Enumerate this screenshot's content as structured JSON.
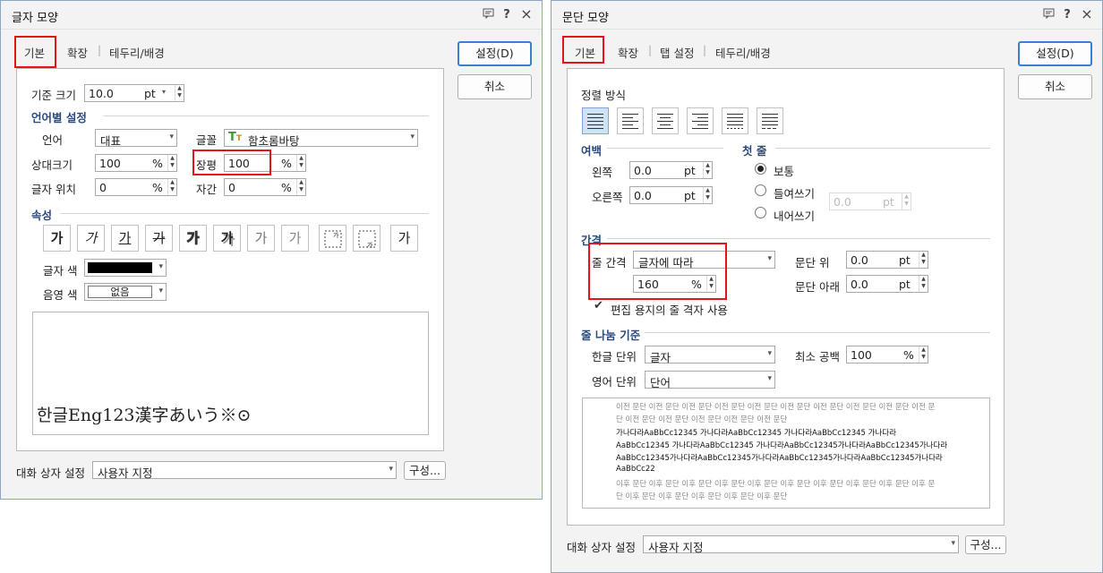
{
  "char_dialog": {
    "title": "글자 모양",
    "tabs": [
      "기본",
      "확장",
      "테두리/배경"
    ],
    "buttons": {
      "ok": "설정(D)",
      "cancel": "취소",
      "config": "구성..."
    },
    "base_size": {
      "label": "기준 크기",
      "value": "10.0",
      "unit": "pt"
    },
    "lang_section": "언어별 설정",
    "language": {
      "label": "언어",
      "value": "대표"
    },
    "font": {
      "label": "글꼴",
      "value": "함초롬바탕",
      "icon": "truetype-font-icon"
    },
    "rel_size": {
      "label": "상대크기",
      "value": "100",
      "unit": "%"
    },
    "width_ratio": {
      "label": "장평",
      "value": "100",
      "unit": "%"
    },
    "char_pos": {
      "label": "글자 위치",
      "value": "0",
      "unit": "%"
    },
    "spacing": {
      "label": "자간",
      "value": "0",
      "unit": "%"
    },
    "attr_section": "속성",
    "attributes": [
      "가",
      "가",
      "가",
      "가",
      "가",
      "가",
      "가",
      "가",
      "가"
    ],
    "text_color": {
      "label": "글자 색",
      "value": "#000000"
    },
    "shade_color": {
      "label": "음영 색",
      "value": "없음"
    },
    "preview_text": "한글Eng123漢字あいう※⊙",
    "dialog_setting": {
      "label": "대화 상자 설정",
      "value": "사용자 지정"
    }
  },
  "para_dialog": {
    "title": "문단 모양",
    "tabs": [
      "기본",
      "확장",
      "탭 설정",
      "테두리/배경"
    ],
    "buttons": {
      "ok": "설정(D)",
      "cancel": "취소",
      "config": "구성..."
    },
    "align_label": "정렬 방식",
    "align_options": [
      "justify-align-icon",
      "left-align-icon",
      "center-align-icon",
      "right-align-icon",
      "distribute-align-icon",
      "divide-align-icon"
    ],
    "margin_section": "여백",
    "left": {
      "label": "왼쪽",
      "value": "0.0",
      "unit": "pt"
    },
    "right": {
      "label": "오른쪽",
      "value": "0.0",
      "unit": "pt"
    },
    "first_line_section": "첫 줄",
    "first_line_options": [
      "보통",
      "들여쓰기",
      "내어쓰기"
    ],
    "first_line_value": {
      "value": "0.0",
      "unit": "pt"
    },
    "spacing_section": "간격",
    "line_spacing": {
      "label": "줄 간격",
      "value": "글자에 따라",
      "amount": "160",
      "unit": "%"
    },
    "para_above": {
      "label": "문단 위",
      "value": "0.0",
      "unit": "pt"
    },
    "para_below": {
      "label": "문단 아래",
      "value": "0.0",
      "unit": "pt"
    },
    "grid_check": "편집 용지의 줄 격자 사용",
    "break_section": "줄 나눔 기준",
    "korean_unit": {
      "label": "한글 단위",
      "value": "글자"
    },
    "english_unit": {
      "label": "영어 단위",
      "value": "단어"
    },
    "min_space": {
      "label": "최소 공백",
      "value": "100",
      "unit": "%"
    },
    "preview_lines": [
      "이전 문단 이전 문단 이전 문단 이전 문단 이전 문단 이전 문단 이전 문단 이전 문단 이전 문단 이전 문",
      "단 이전 문단 이전 문단 이전 문단 이전 문단 이전 문단",
      "가나다라AaBbCc12345    가나다라AaBbCc12345    가나다라AaBbCc12345    가나다라",
      "AaBbCc12345 가나다라AaBbCc12345 가나다라AaBbCc12345가나다라AaBbCc12345가나다라",
      "AaBbCc12345가나다라AaBbCc12345가나다라AaBbCc12345가나다라AaBbCc12345가나다라",
      "AaBbCc22",
      "이후 문단 이후 문단 이후 문단 이후 문단 이후 문단 이후 문단 이후 문단 이후 문단 이후 문단 이후 문",
      "단 이후 문단 이후 문단 이후 문단 이후 문단 이후 문단"
    ],
    "dialog_setting": {
      "label": "대화 상자 설정",
      "value": "사용자 지정"
    }
  },
  "titlebar_icons": {
    "help": "?",
    "close": "×"
  }
}
